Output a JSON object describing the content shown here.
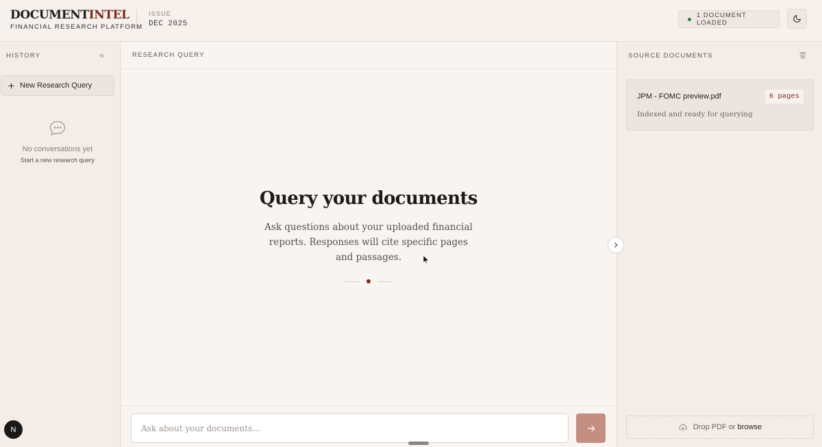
{
  "header": {
    "brand_part1": "DOCUMENT",
    "brand_part2": "INTEL",
    "subtitle": "FINANCIAL RESEARCH PLATFORM",
    "issue_label": "ISSUE",
    "issue_value": "DEC 2025",
    "status": "1 DOCUMENT LOADED",
    "theme_icon": "moon-icon"
  },
  "sidebar": {
    "title": "HISTORY",
    "new_query_label": "New Research Query",
    "empty_title": "No conversations yet",
    "empty_sub": "Start a new research query",
    "avatar_letter": "N"
  },
  "main": {
    "title": "RESEARCH QUERY",
    "hero_title": "Query your documents",
    "hero_desc": "Ask questions about your uploaded financial reports. Responses will cite specific pages and passages.",
    "input_placeholder": "Ask about your documents..."
  },
  "documents": {
    "title": "SOURCE DOCUMENTS",
    "items": [
      {
        "name": "JPM - FOMC preview.pdf",
        "pages": "6 pages",
        "status": "Indexed and ready for querying"
      }
    ],
    "drop_text": "Drop PDF or",
    "browse_text": "browse"
  },
  "colors": {
    "accent": "#7a2a1c",
    "status_ok": "#2c7a3d",
    "send_button": "#c48f82"
  }
}
